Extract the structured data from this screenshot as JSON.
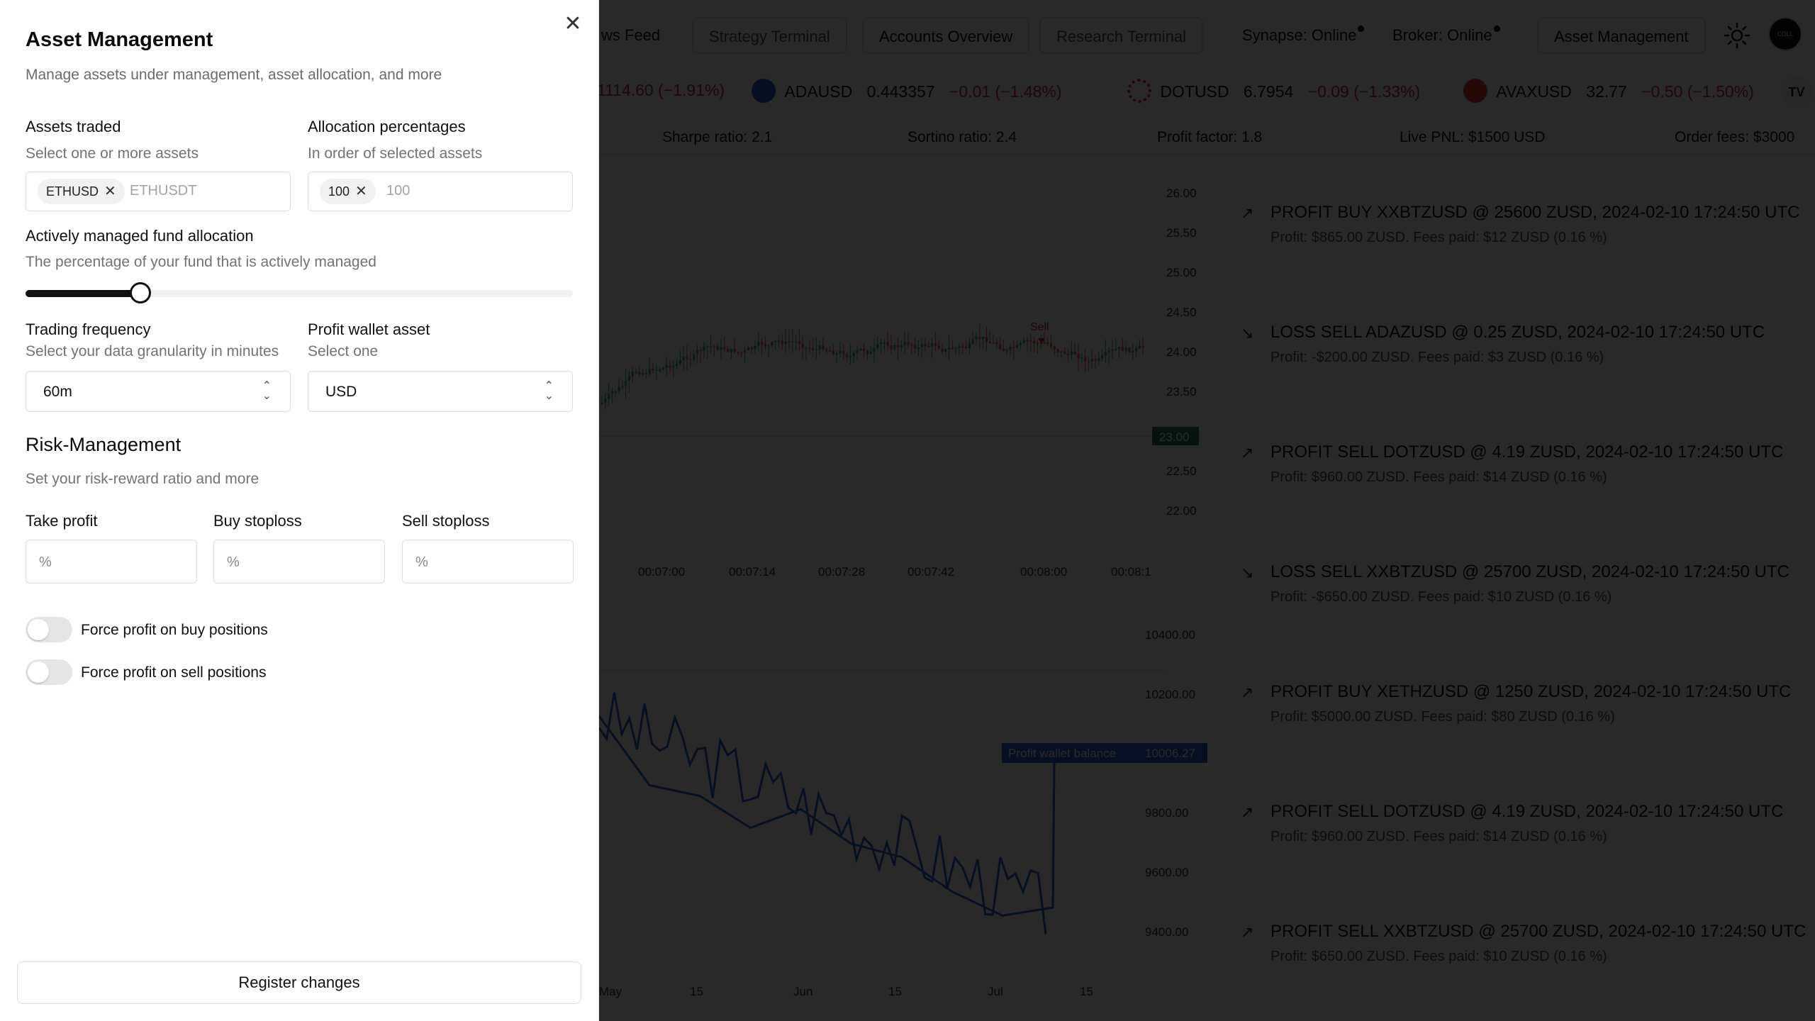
{
  "nav": {
    "tabs": [
      {
        "label": "ws Feed"
      },
      {
        "label": "Strategy Terminal"
      },
      {
        "label": "Accounts Overview"
      },
      {
        "label": "Research Terminal"
      }
    ],
    "synapse_status": "Synapse: Online",
    "broker_status": "Broker: Online",
    "asset_management": "Asset Management",
    "avatar_text": "CDLL",
    "theme_icon": "sun-icon"
  },
  "ticker": [
    {
      "symbol": "",
      "price": "1114.60",
      "change": "(−1.91%)",
      "icon": "coin-icon",
      "color": "#2f4bb3"
    },
    {
      "symbol": "ADAUSD",
      "price": "0.443357",
      "change": "−0.01 (−1.48%)",
      "icon": "cardano-icon",
      "color": "#2a5ada"
    },
    {
      "symbol": "DOTUSD",
      "price": "6.7954",
      "change": "−0.09 (−1.33%)",
      "icon": "polkadot-icon",
      "color": "#e6007a"
    },
    {
      "symbol": "AVAXUSD",
      "price": "32.77",
      "change": "−0.50 (−1.50%)",
      "icon": "avalanche-icon",
      "color": "#e84142"
    }
  ],
  "ticker_logo": "TV",
  "stats": [
    {
      "label": "Sharpe ratio: 2.1"
    },
    {
      "label": "Sortino ratio: 2.4"
    },
    {
      "label": "Profit factor: 1.8"
    },
    {
      "label": "Live PNL: $1500 USD"
    },
    {
      "label": "Order fees: $3000"
    }
  ],
  "price_chart": {
    "y_ticks": [
      "26.00",
      "25.50",
      "25.00",
      "24.50",
      "24.00",
      "23.50",
      "23.00",
      "22.50",
      "22.00"
    ],
    "current_price": "23.00",
    "x_ticks": [
      "00:07:00",
      "00:07:14",
      "00:07:28",
      "00:07:42",
      "00:08:00",
      "00:08:1"
    ],
    "marker": "Sell"
  },
  "balance_chart": {
    "y_ticks": [
      "10400.00",
      "10200.00",
      "9800.00",
      "9600.00",
      "9400.00"
    ],
    "x_ticks": [
      "May",
      "15",
      "Jun",
      "15",
      "Jul",
      "15"
    ],
    "series_label": "Profit wallet balance",
    "series_value": "10006.27"
  },
  "chart_data": {
    "type": "line",
    "x_labels": [
      "May",
      "15",
      "Jun",
      "15",
      "Jul",
      "15"
    ],
    "series": [
      {
        "name": "Profit wallet balance",
        "values": [
          10180,
          9920,
          9880,
          9760,
          9830,
          9700,
          9650,
          9520,
          9430,
          9460,
          10006.27
        ]
      }
    ],
    "ylim": [
      9300,
      10500
    ]
  },
  "trades": [
    {
      "title": "PROFIT BUY XXBTZUSD @ 25600 ZUSD, 2024-02-10 17:24:50 UTC",
      "sub": "Profit: $865.00 ZUSD. Fees paid: $12 ZUSD (0.16 %)",
      "arrow": "↗"
    },
    {
      "title": "LOSS SELL ADAZUSD @ 0.25 ZUSD, 2024-02-10 17:24:50 UTC",
      "sub": "Profit: -$200.00 ZUSD. Fees paid: $3 ZUSD (0.16 %)",
      "arrow": "↘"
    },
    {
      "title": "PROFIT SELL DOTZUSD @ 4.19 ZUSD, 2024-02-10 17:24:50 UTC",
      "sub": "Profit: $960.00 ZUSD. Fees paid: $14 ZUSD (0.16 %)",
      "arrow": "↗"
    },
    {
      "title": "LOSS SELL XXBTZUSD @ 25700 ZUSD, 2024-02-10 17:24:50 UTC",
      "sub": "Profit: -$650.00 ZUSD. Fees paid: $10 ZUSD (0.16 %)",
      "arrow": "↘"
    },
    {
      "title": "PROFIT BUY XETHZUSD @ 1250 ZUSD, 2024-02-10 17:24:50 UTC",
      "sub": "Profit: $5000.00 ZUSD. Fees paid: $80 ZUSD (0.16 %)",
      "arrow": "↗"
    },
    {
      "title": "PROFIT SELL DOTZUSD @ 4.19 ZUSD, 2024-02-10 17:24:50 UTC",
      "sub": "Profit: $960.00 ZUSD. Fees paid: $14 ZUSD (0.16 %)",
      "arrow": "↗"
    },
    {
      "title": "PROFIT SELL XXBTZUSD @ 25700 ZUSD, 2024-02-10 17:24:50 UTC",
      "sub": "Profit: $650.00 ZUSD. Fees paid: $10 ZUSD (0.16 %)",
      "arrow": "↗"
    }
  ],
  "panel": {
    "title": "Asset Management",
    "subtitle": "Manage assets under management, asset allocation, and more",
    "close_icon": "close-icon",
    "assets": {
      "label": "Assets traded",
      "hint": "Select one or more assets",
      "chip": "ETHUSD",
      "placeholder": "ETHUSDT"
    },
    "allocation": {
      "label": "Allocation percentages",
      "hint": "In order of selected assets",
      "chip": "100",
      "placeholder": "100"
    },
    "fund": {
      "label": "Actively managed fund allocation",
      "hint": "The percentage of your fund that is actively managed",
      "value_fraction": 0.21
    },
    "frequency": {
      "label": "Trading frequency",
      "hint": "Select your data granularity in minutes",
      "value": "60m"
    },
    "wallet": {
      "label": "Profit wallet asset",
      "hint": "Select one",
      "value": "USD"
    },
    "risk": {
      "title": "Risk-Management",
      "hint": "Set your risk-reward ratio and more",
      "take_profit": {
        "label": "Take profit",
        "placeholder": "%"
      },
      "buy_stoploss": {
        "label": "Buy stoploss",
        "placeholder": "%"
      },
      "sell_stoploss": {
        "label": "Sell stoploss",
        "placeholder": "%"
      }
    },
    "toggles": [
      {
        "label": "Force profit on buy positions",
        "on": false
      },
      {
        "label": "Force profit on sell positions",
        "on": false
      }
    ],
    "submit": "Register changes"
  }
}
